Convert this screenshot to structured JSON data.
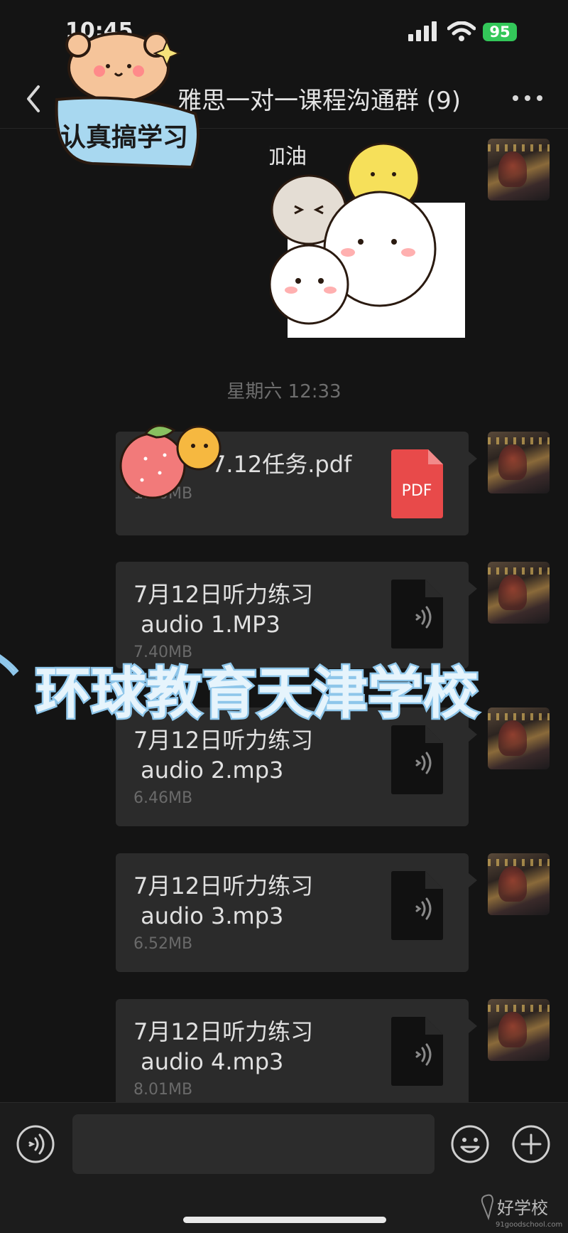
{
  "status": {
    "time": "10:45",
    "battery": "95"
  },
  "chat": {
    "title": "雅思一对一课程沟通群 (9)"
  },
  "stickers": {
    "bear_text": "认真搞学习",
    "cheer_text": "加油"
  },
  "timestamp": "星期六 12:33",
  "files": [
    {
      "name": "7.12任务.pdf",
      "size": "1.20MB",
      "type": "pdf",
      "icon_label": "PDF"
    },
    {
      "name": "7月12日听力练习\n audio 1.MP3",
      "size": "7.40MB",
      "type": "audio"
    },
    {
      "name": "7月12日听力练习\n audio 2.mp3",
      "size": "6.46MB",
      "type": "audio"
    },
    {
      "name": "7月12日听力练习\n audio 3.mp3",
      "size": "6.52MB",
      "type": "audio"
    },
    {
      "name": "7月12日听力练习\n audio 4.mp3",
      "size": "8.01MB",
      "type": "audio"
    }
  ],
  "watermark": "环球教育天津学校",
  "logo": {
    "text": "好学校",
    "sub": "91goodschool.com"
  },
  "colors": {
    "bubble": "#2b2b2b",
    "pdf_red": "#e84a4a",
    "battery_green": "#33c759",
    "background": "#141414"
  }
}
